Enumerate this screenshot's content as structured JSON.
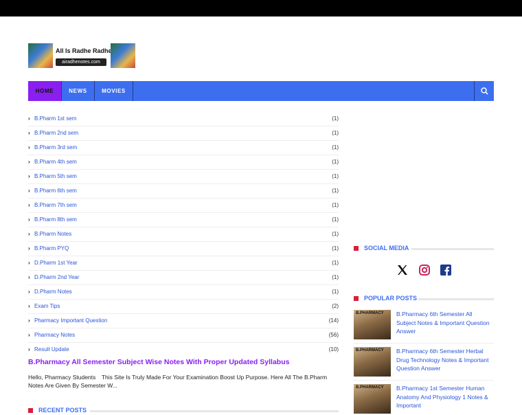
{
  "site": {
    "brand": "All Is Radhe Radhe",
    "url": "airadhenotes.com"
  },
  "nav": {
    "tabs": [
      {
        "label": "HOME"
      },
      {
        "label": "NEWS"
      },
      {
        "label": "MOVIES"
      }
    ],
    "search_icon": "search-icon"
  },
  "labels": [
    {
      "name": "B.Pharm 1st sem",
      "count": "(1)"
    },
    {
      "name": "B.Pharm 2nd sem",
      "count": "(1)"
    },
    {
      "name": "B.Pharm 3rd sem",
      "count": "(1)"
    },
    {
      "name": "B.Pharm 4th sem",
      "count": "(1)"
    },
    {
      "name": "B.Pharm 5th sem",
      "count": "(1)"
    },
    {
      "name": "B.Pharm 6th sem",
      "count": "(1)"
    },
    {
      "name": "B.Pharm 7th sem",
      "count": "(1)"
    },
    {
      "name": "B.Pharm 8th sem",
      "count": "(1)"
    },
    {
      "name": "B.Pharm Notes",
      "count": "(1)"
    },
    {
      "name": "B.Pharm PYQ",
      "count": "(1)"
    },
    {
      "name": "D.Pharm 1st Year",
      "count": "(1)"
    },
    {
      "name": "D.Pharm 2nd Year",
      "count": "(1)"
    },
    {
      "name": "D.Pharm Notes",
      "count": "(1)"
    },
    {
      "name": "Exam Tips",
      "count": "(2)"
    },
    {
      "name": "Pharmacy Important Question",
      "count": "(14)"
    },
    {
      "name": "Pharmacy Notes",
      "count": "(56)"
    },
    {
      "name": "Result Update",
      "count": "(10)"
    }
  ],
  "post": {
    "title": "B.Pharmacy All Semester Subject Wise Notes With Proper Updated Syllabus",
    "snippet": "Hello, Pharmacy Students⠀ This Site Is Truly Made For Your Examination Boost Up Purpose. Here All The B.Pharm Notes Are Given By Semester W..."
  },
  "recent_posts": {
    "heading": "RECENT POSTS"
  },
  "social": {
    "heading": "SOCIAL MEDIA",
    "icons": [
      "x-icon",
      "instagram-icon",
      "facebook-icon"
    ]
  },
  "popular": {
    "heading": "POPULAR POSTS",
    "thumb_label": "B.PHARMACY",
    "items": [
      {
        "title": "B.Pharmacy 6th Semester All Subject Notes & Important Question Answer"
      },
      {
        "title": "B.Pharmacy 6th Semester Herbal Drug Technology Notes & Important Question Answer"
      },
      {
        "title": "B.Pharmacy 1st Semester Human Anatomy And Physiology 1 Notes & Important"
      }
    ]
  },
  "colors": {
    "accent": "#3d6ef0",
    "active_tab": "#8a1ff0",
    "marker": "#d81f3a"
  }
}
